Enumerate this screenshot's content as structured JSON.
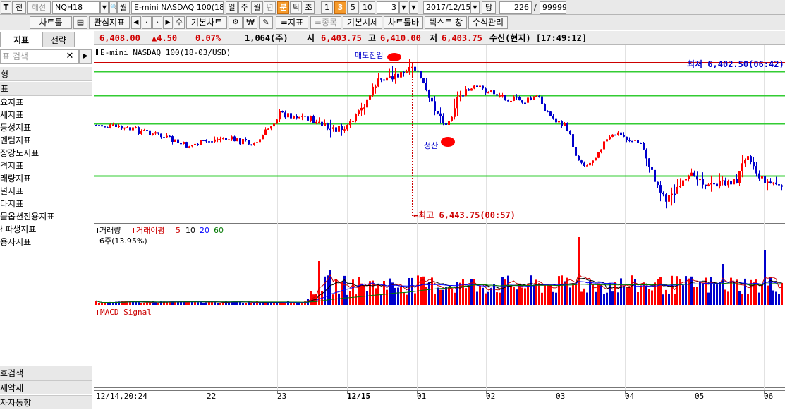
{
  "toolbar1": {
    "btn_t": "T",
    "btn_jeon": "전",
    "btn_haeseon": "해선",
    "symbol": "NQH18",
    "month_label": "월",
    "product_name": "E-mini NASDAQ 100(18-",
    "periods": [
      "일",
      "주",
      "월",
      "년",
      "분",
      "틱",
      "초"
    ],
    "selected_period": "분",
    "intervals": [
      "1",
      "3",
      "5",
      "10"
    ],
    "selected_interval": "3",
    "interval_value": "3",
    "date": "2017/12/15",
    "dang_label": "당",
    "count": "226",
    "slash": "/",
    "max_count": "99999"
  },
  "toolbar2": {
    "chart_tool": "차트툴",
    "fav_indicator": "관심지표",
    "basic_chart": "기본차트",
    "indicator_btn": "=지표",
    "item_btn": "=종목",
    "basic_quote": "기본시세",
    "chart_toolbar": "차트툴바",
    "text_window": "텍스트 창",
    "formula_mgmt": "수식관리",
    "won_symbol": "₩"
  },
  "left_panel": {
    "tab_indicator": "지표",
    "tab_strategy": "전략",
    "search_placeholder": "표 검색",
    "category1": "형",
    "category2": "표",
    "items": [
      "요지표",
      "세지표",
      "동성지표",
      "멘텀지표",
      "장강도지표",
      "격지표",
      "래량지표",
      "널지표",
      "타지표",
      "물옵션전용지표",
      "ł 파생지표",
      "용자지표"
    ],
    "bottom_items": [
      "호검색",
      "세약세",
      "자자동향"
    ]
  },
  "quote": {
    "price": "6,408.00",
    "change": "▲4.50",
    "change_pct": "0.07%",
    "volume": "1,064(주)",
    "open_label": "시",
    "open": "6,403.75",
    "high_label": "고",
    "high": "6,410.00",
    "low_label": "저",
    "low": "6,403.75",
    "status": "수신(현지) [17:49:12]"
  },
  "colors": {
    "up": "#ff0000",
    "down": "#0000cc",
    "level_line": "#33cc33",
    "ma5": "#cc0000",
    "ma10": "#000000",
    "ma20": "#0000ff",
    "ma60": "#007700"
  },
  "chart": {
    "title": "E-mini NASDAQ 100(18-03/USD)",
    "low_annotation": "최저 6,402.50(06:42)",
    "high_annotation": "←최고 6,443.75(00:57)",
    "sell_entry_label": "매도진입",
    "close_label": "청산",
    "volume_label": "거래량",
    "volume_ma_label": "거래이평",
    "volume_ma_periods": [
      "5",
      "10",
      "20",
      "60"
    ],
    "volume_info": "6주(13.95%)",
    "macd_label": "MACD Signal",
    "x_labels": [
      "12/14,20:24",
      "22",
      "23",
      "12/15",
      "01",
      "02",
      "03",
      "04",
      "05",
      "06"
    ]
  }
}
